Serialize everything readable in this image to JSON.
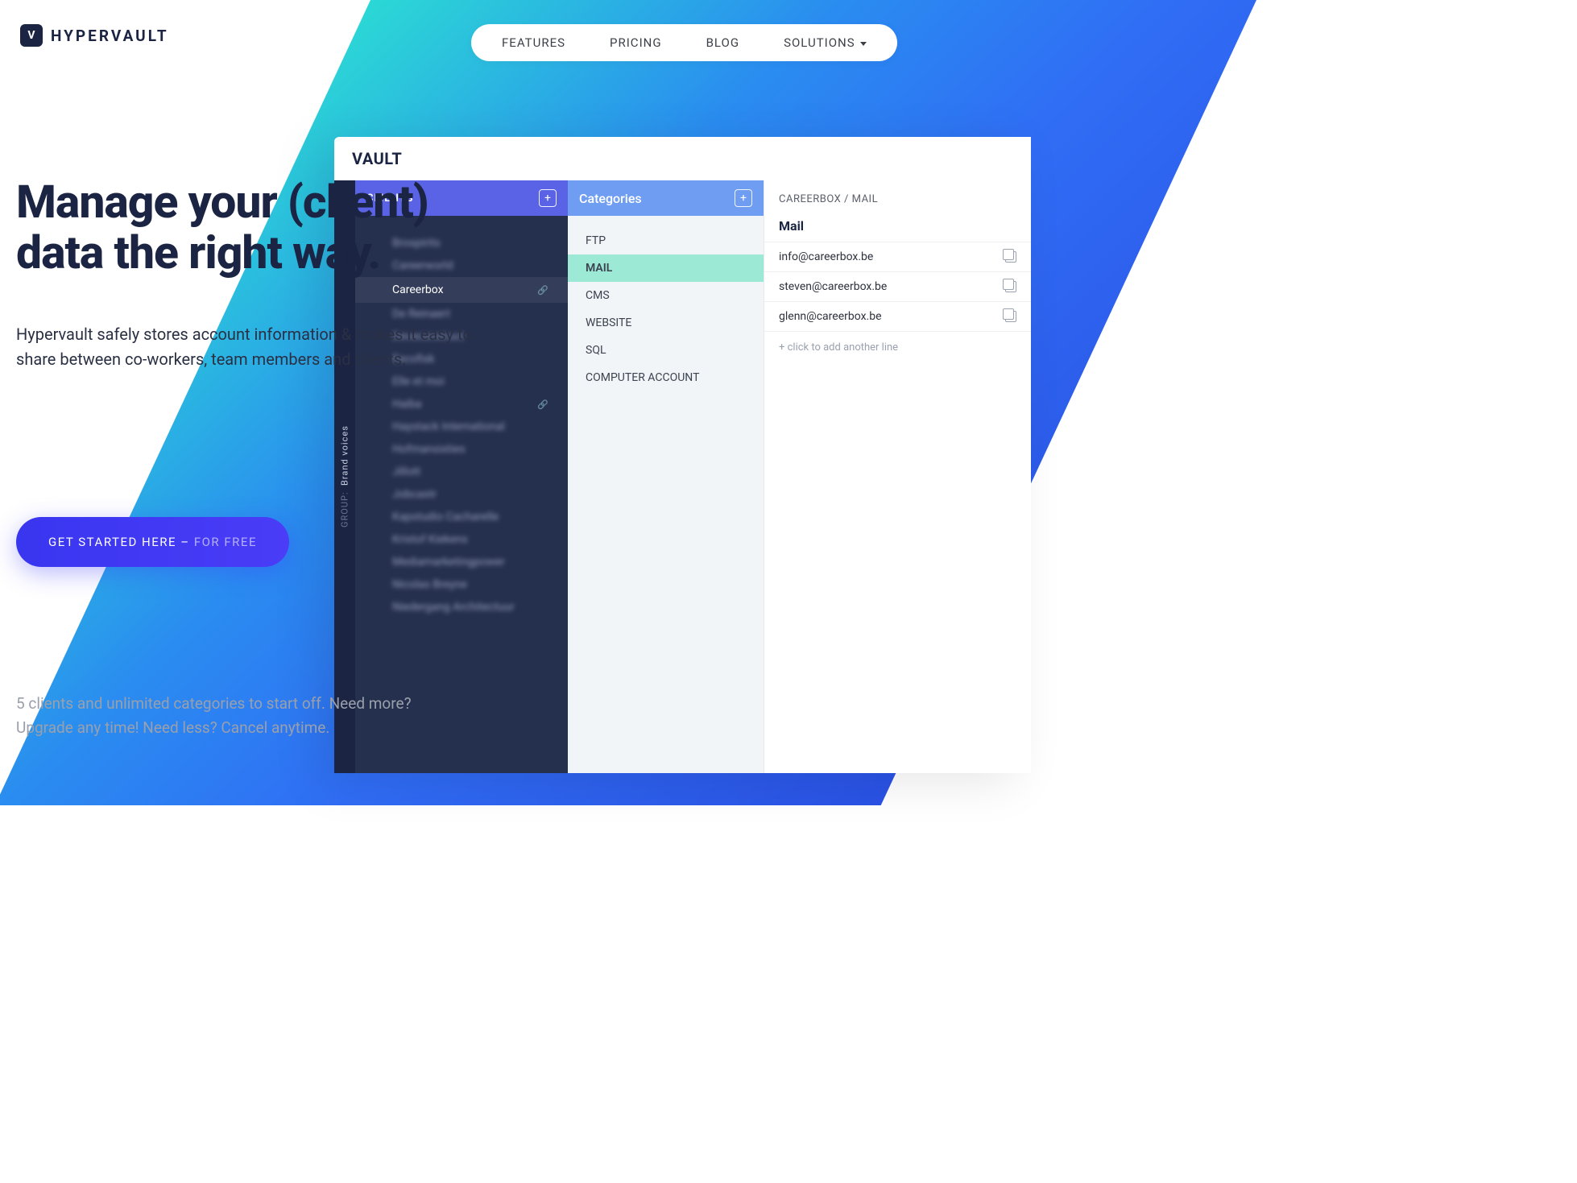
{
  "brand": {
    "mark": "V",
    "name": "HYPERVAULT"
  },
  "nav": {
    "features": "FEATURES",
    "pricing": "PRICING",
    "blog": "BLOG",
    "solutions": "SOLUTIONS"
  },
  "hero": {
    "title_line1": "Manage your (client)",
    "title_line2": "data the right way.",
    "sub": "Hypervault safely stores account information & makes it easy to share between co-workers, team members and clients.",
    "cta_main": "GET STARTED HERE – ",
    "cta_faded": "FOR FREE",
    "note_line1": "5 clients and unlimited categories to start off. Need more?",
    "note_line2": "Upgrade any time! Need less? Cancel anytime."
  },
  "app": {
    "title": "VAULT",
    "group_label": "GROUP:",
    "group_value": "Brand voices",
    "clients_header": "CLIENTS",
    "clients": [
      {
        "label": "Brospirits",
        "blur": true
      },
      {
        "label": "Careerworld",
        "blur": true
      },
      {
        "label": "Careerbox",
        "blur": false,
        "active": true,
        "linked": true
      },
      {
        "label": "De Reinaert",
        "blur": true
      },
      {
        "label": "Deveconstruct",
        "blur": true
      },
      {
        "label": "Eecofisk",
        "blur": true
      },
      {
        "label": "Elle et moi",
        "blur": true
      },
      {
        "label": "Haiba",
        "blur": true,
        "linked": true
      },
      {
        "label": "Haystack International",
        "blur": true
      },
      {
        "label": "Hofmansixties",
        "blur": true
      },
      {
        "label": "Jillott",
        "blur": true
      },
      {
        "label": "Jobcastr",
        "blur": true
      },
      {
        "label": "Kapstudio Cacharelle",
        "blur": true
      },
      {
        "label": "Kristof Kiekens",
        "blur": true
      },
      {
        "label": "Mediamarketingpower",
        "blur": true
      },
      {
        "label": "Nicolas Breyne",
        "blur": true
      },
      {
        "label": "Niedergang Architectuur",
        "blur": true
      }
    ],
    "categories_header": "Categories",
    "categories": [
      {
        "label": "FTP"
      },
      {
        "label": "MAIL",
        "active": true
      },
      {
        "label": "CMS"
      },
      {
        "label": "WEBSITE"
      },
      {
        "label": "SQL"
      },
      {
        "label": "COMPUTER ACCOUNT"
      }
    ],
    "detail": {
      "breadcrumb": "CAREERBOX / MAIL",
      "heading": "Mail",
      "rows": [
        "info@careerbox.be",
        "steven@careerbox.be",
        "glenn@careerbox.be"
      ],
      "add_text": "+ click to add another line"
    }
  }
}
